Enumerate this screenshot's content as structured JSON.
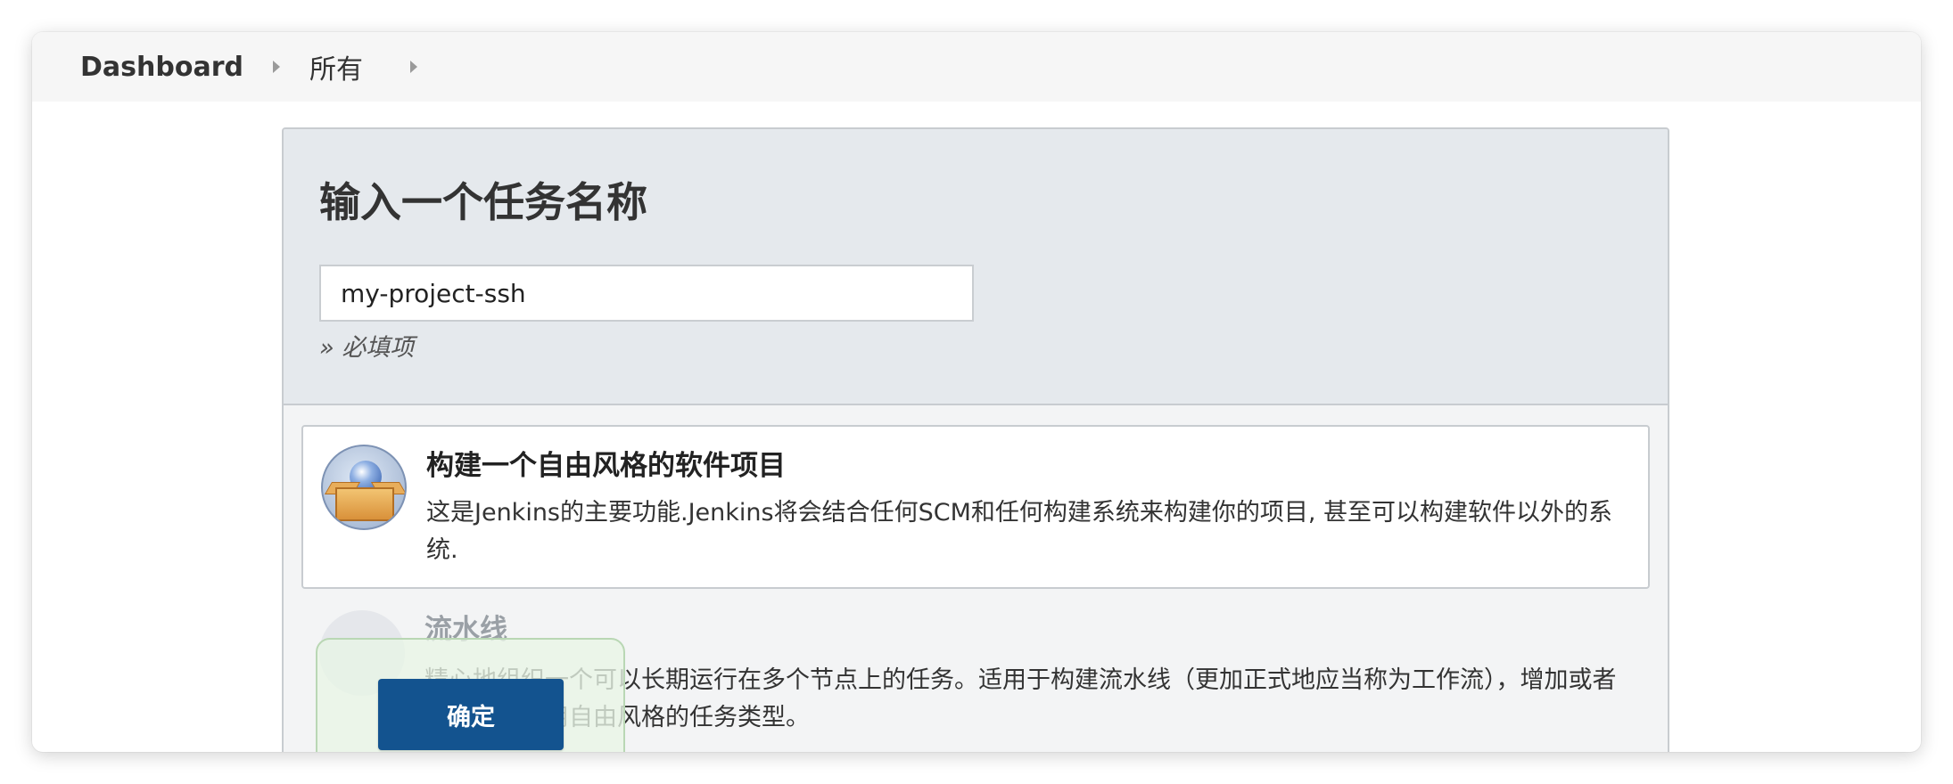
{
  "breadcrumb": {
    "items": [
      {
        "label": "Dashboard"
      },
      {
        "label": "所有"
      }
    ]
  },
  "form": {
    "title": "输入一个任务名称",
    "name_value": "my-project-ssh",
    "required_hint": "» 必填项"
  },
  "items": [
    {
      "title": "构建一个自由风格的软件项目",
      "description": "这是Jenkins的主要功能.Jenkins将会结合任何SCM和任何构建系统来构建你的项目, 甚至可以构建软件以外的系统.",
      "icon": "freestyle-box-icon"
    },
    {
      "title": "流水线",
      "description": "精心地组织一个可以长期运行在多个节点上的任务。适用于构建流水线（更加正式地应当称为工作流），增加或者组织难以采用自由风格的任务类型。",
      "icon": "pipeline-icon"
    }
  ],
  "footer": {
    "ok_label": "确定"
  },
  "colors": {
    "button": "#13538f",
    "header_bg": "#e5e9ed",
    "breadcrumb_bg": "#f6f6f6"
  }
}
